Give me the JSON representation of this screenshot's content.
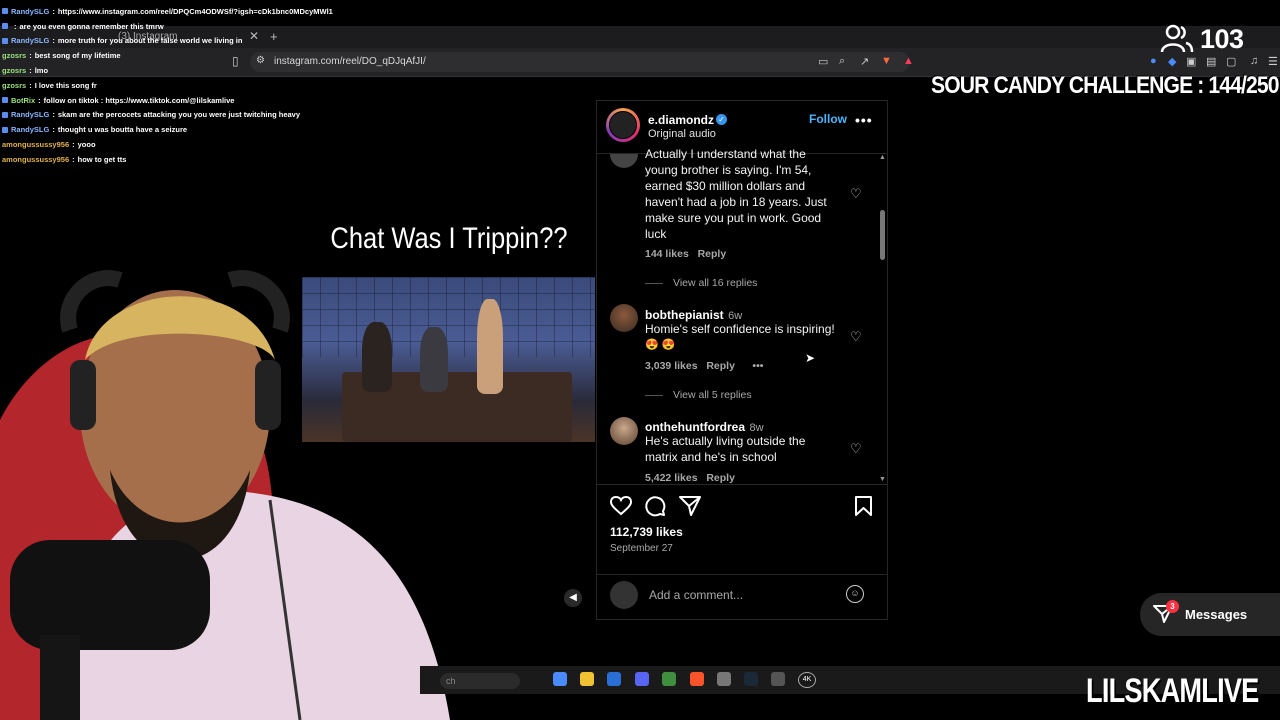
{
  "chat": [
    {
      "user": "RandySLG",
      "message": "https://www.instagram.com/reel/DPQCm4ODWSf/?igsh=cDk1bnc0MDcyMWl1",
      "user_color": "blue",
      "badge": "blue"
    },
    {
      "user": "",
      "message": "are you even gonna remember this tmrw",
      "user_color": "blue",
      "badge": "blue"
    },
    {
      "user": "RandySLG",
      "message": "more truth for you about the false world we living in",
      "user_color": "blue",
      "badge": "blue"
    },
    {
      "user": "gzosrs",
      "message": "best song of my lifetime",
      "user_color": "green",
      "badge": ""
    },
    {
      "user": "gzosrs",
      "message": "lmo",
      "user_color": "green",
      "badge": ""
    },
    {
      "user": "gzosrs",
      "message": "I love this song fr",
      "user_color": "green",
      "badge": ""
    },
    {
      "user": "BotRix",
      "message": "follow on tiktok : https://www.tiktok.com/@lilskamlive",
      "user_color": "green",
      "badge": "blue"
    },
    {
      "user": "RandySLG",
      "message": "skam are the percocets attacking you you were just twitching heavy bro",
      "user_color": "blue",
      "badge": "blue"
    },
    {
      "user": "RandySLG",
      "message": "thought u was boutta have a seizure",
      "user_color": "blue",
      "badge": "blue"
    },
    {
      "user": "amongussussy956",
      "message": "yooo",
      "user_color": "gold",
      "badge": ""
    },
    {
      "user": "amongussussy956",
      "message": "how to get tts",
      "user_color": "gold",
      "badge": ""
    }
  ],
  "browser": {
    "tab_title": "(3) Instagram",
    "url": "instagram.com/reel/DO_qDJqAfJI/"
  },
  "overlay": {
    "viewer_count": "103",
    "challenge": "SOUR CANDY CHALLENGE : 144/250",
    "brand": "LILSKAMLIVE"
  },
  "video": {
    "caption": "Chat Was I Trippin??"
  },
  "post": {
    "username": "e.diamondz",
    "audio": "Original audio",
    "follow_label": "Follow",
    "more_label": "•••",
    "likes": "112,739 likes",
    "date": "September 27",
    "add_comment_placeholder": "Add a comment..."
  },
  "comments": [
    {
      "user": "",
      "time": "",
      "text": "Actually I understand what the young brother is saying. I'm 54, earned $30 million dollars and haven't had a job in 18 years. Just make sure you put in work. Good luck",
      "likes": "144 likes",
      "reply": "Reply",
      "view_replies": "View all 16 replies"
    },
    {
      "user": "bobthepianist",
      "time": "6w",
      "text": "Homie's self confidence is inspiring!",
      "emoji": "😍 😍",
      "likes": "3,039 likes",
      "reply": "Reply",
      "more": "•••",
      "view_replies": "View all 5 replies"
    },
    {
      "user": "onthehuntfordrea",
      "time": "8w",
      "text": "He's actually living outside the matrix and he's in school",
      "likes": "5,422 likes",
      "reply": "Reply"
    }
  ],
  "messages": {
    "label": "Messages",
    "badge": "3"
  },
  "taskbar": {
    "search": "ch",
    "fourk": "4K"
  }
}
